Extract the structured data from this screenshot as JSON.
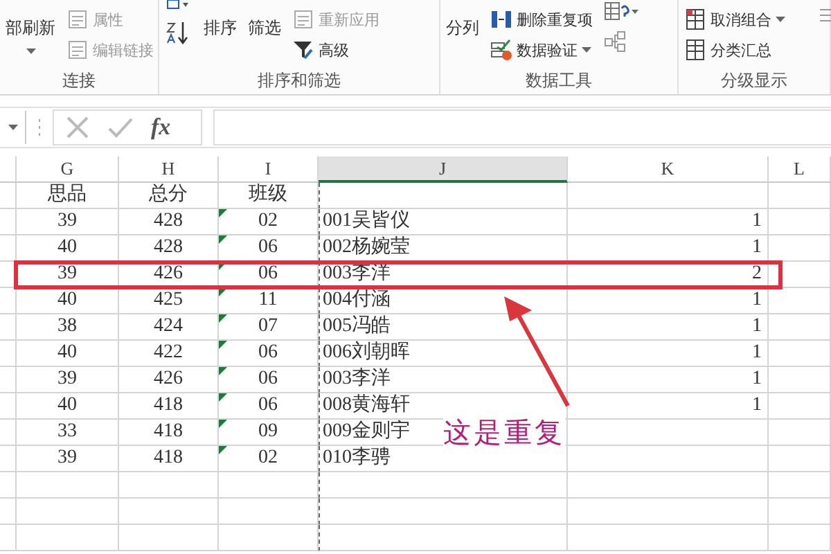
{
  "ribbon": {
    "groups": [
      {
        "label": "连接",
        "items": [
          {
            "kind": "large",
            "label": "部刷新",
            "disabled": false,
            "dropdown": true
          },
          {
            "kind": "small",
            "label": "属性",
            "disabled": true
          },
          {
            "kind": "small",
            "label": "编辑链接",
            "disabled": true
          }
        ]
      },
      {
        "label": "排序和筛选",
        "items": [
          {
            "kind": "sortpair"
          },
          {
            "kind": "large",
            "label": "排序",
            "disabled": false
          },
          {
            "kind": "large",
            "label": "筛选",
            "disabled": false
          },
          {
            "kind": "small",
            "label": "重新应用",
            "disabled": true
          },
          {
            "kind": "small",
            "label": "高级",
            "disabled": false
          }
        ]
      },
      {
        "label": "数据工具",
        "items": [
          {
            "kind": "large",
            "label": "分列",
            "disabled": false
          },
          {
            "kind": "small",
            "label": "删除重复项",
            "disabled": false
          },
          {
            "kind": "small",
            "label": "数据验证",
            "disabled": false,
            "dropdown": true
          },
          {
            "kind": "iconpair"
          }
        ]
      },
      {
        "label": "分级显示",
        "items": [
          {
            "kind": "small",
            "label": "取消组合",
            "disabled": false,
            "dropdown": true
          },
          {
            "kind": "small",
            "label": "分类汇总",
            "disabled": false
          }
        ]
      }
    ]
  },
  "formula_bar": {
    "fx": "fx"
  },
  "columns": [
    {
      "label": "G",
      "selected": false
    },
    {
      "label": "H",
      "selected": false
    },
    {
      "label": "I",
      "selected": false
    },
    {
      "label": "J",
      "selected": true
    },
    {
      "label": "K",
      "selected": false
    },
    {
      "label": "L",
      "selected": false
    }
  ],
  "header_row": {
    "g": "思品",
    "h": "总分",
    "i": "班级"
  },
  "rows": [
    {
      "g": "39",
      "h": "428",
      "i": "02",
      "i_flagged": true,
      "name": "001吴皆仪",
      "count": "1",
      "highlighted": false
    },
    {
      "g": "40",
      "h": "428",
      "i": "06",
      "i_flagged": true,
      "name": "002杨婉莹",
      "count": "1",
      "highlighted": false
    },
    {
      "g": "39",
      "h": "426",
      "i": "06",
      "i_flagged": true,
      "name": "003李洋",
      "count": "2",
      "highlighted": true
    },
    {
      "g": "40",
      "h": "425",
      "i": "11",
      "i_flagged": true,
      "name": "004付涵",
      "count": "1",
      "highlighted": false
    },
    {
      "g": "38",
      "h": "424",
      "i": "07",
      "i_flagged": true,
      "name": "005冯皓",
      "count": "1",
      "highlighted": false
    },
    {
      "g": "40",
      "h": "422",
      "i": "06",
      "i_flagged": true,
      "name": "006刘朝晖",
      "count": "1",
      "highlighted": false
    },
    {
      "g": "39",
      "h": "426",
      "i": "06",
      "i_flagged": true,
      "name": "003李洋",
      "count": "1",
      "highlighted": false
    },
    {
      "g": "40",
      "h": "418",
      "i": "06",
      "i_flagged": true,
      "name": "008黄海轩",
      "count": "1",
      "highlighted": false
    },
    {
      "g": "33",
      "h": "418",
      "i": "09",
      "i_flagged": true,
      "name": "009金则宇",
      "highlighted": false
    },
    {
      "g": "39",
      "h": "418",
      "i": "02",
      "i_flagged": true,
      "name": "010李骋",
      "highlighted": false
    }
  ],
  "annotation": {
    "text": "这是重复"
  }
}
